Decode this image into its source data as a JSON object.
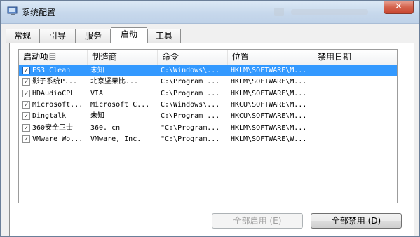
{
  "window": {
    "title": "系统配置",
    "close_label": "✕"
  },
  "tabs": [
    {
      "label": "常规"
    },
    {
      "label": "引导"
    },
    {
      "label": "服务"
    },
    {
      "label": "启动",
      "active": true
    },
    {
      "label": "工具"
    }
  ],
  "table": {
    "columns": [
      "启动项目",
      "制造商",
      "命令",
      "位置",
      "禁用日期"
    ],
    "rows": [
      {
        "checked": true,
        "item": "ES3_Clean",
        "maker": "未知",
        "command": "C:\\Windows\\...",
        "location": "HKLM\\SOFTWARE\\M...",
        "disabled_date": ""
      },
      {
        "checked": true,
        "item": "影子系统P...",
        "maker": "北京坚果比...",
        "command": "C:\\Program ...",
        "location": "HKLM\\SOFTWARE\\M...",
        "disabled_date": ""
      },
      {
        "checked": true,
        "item": "HDAudioCPL",
        "maker": "VIA",
        "command": "C:\\Program ...",
        "location": "HKLM\\SOFTWARE\\M...",
        "disabled_date": ""
      },
      {
        "checked": true,
        "item": "Microsoft...",
        "maker": "Microsoft C...",
        "command": "C:\\Windows\\...",
        "location": "HKCU\\SOFTWARE\\M...",
        "disabled_date": ""
      },
      {
        "checked": true,
        "item": "Dingtalk",
        "maker": "未知",
        "command": "C:\\Program ...",
        "location": "HKCU\\SOFTWARE\\M...",
        "disabled_date": ""
      },
      {
        "checked": true,
        "item": "360安全卫士",
        "maker": "360. cn",
        "command": "\"C:\\Program...",
        "location": "HKLM\\SOFTWARE\\M...",
        "disabled_date": ""
      },
      {
        "checked": true,
        "item": "VMware Wo...",
        "maker": "VMware, Inc.",
        "command": "\"C:\\Program...",
        "location": "HKLM\\SOFTWARE\\W...",
        "disabled_date": ""
      }
    ],
    "selected_index": 0
  },
  "buttons": {
    "enable_all": "全部启用 (E)",
    "disable_all": "全部禁用 (D)"
  },
  "colors": {
    "selection": "#3399ff",
    "close": "#c84630"
  }
}
